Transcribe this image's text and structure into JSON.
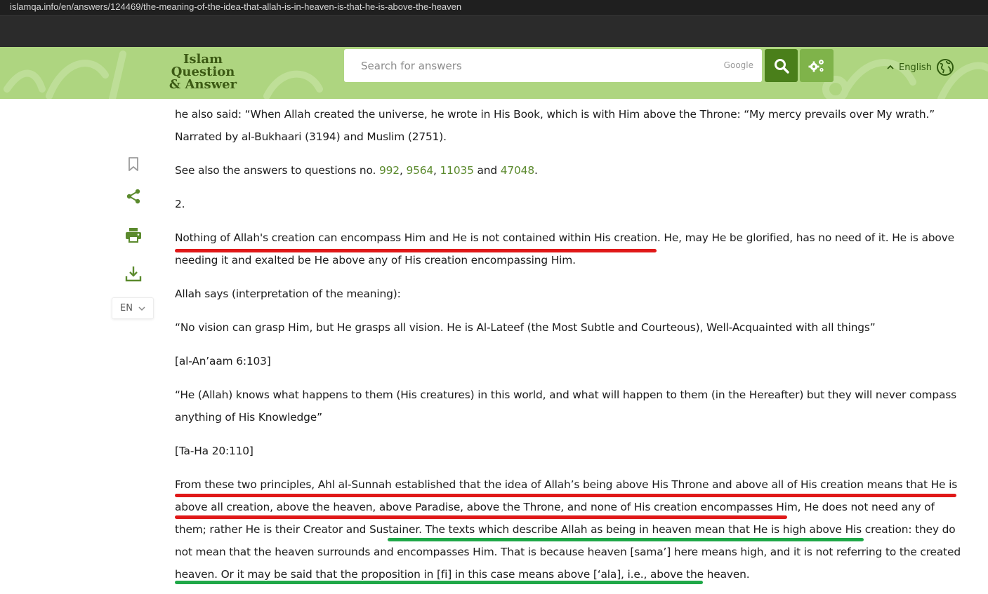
{
  "browser": {
    "url": "islamqa.info/en/answers/124469/the-meaning-of-the-idea-that-allah-is-in-heaven-is-that-he-is-above-the-heaven"
  },
  "header": {
    "logo_line1": "Islam Question",
    "logo_line2": "& Answer",
    "search_placeholder": "Search for answers",
    "search_provider": "Google",
    "language_label": "English",
    "colors": {
      "header_bg": "#aed580",
      "search_button": "#4a7f1a",
      "settings_button": "#7fb34a",
      "accent": "#5b8a2d"
    }
  },
  "sidebar_tools": {
    "icons": [
      "bookmark-icon",
      "share-icon",
      "print-icon",
      "download-icon"
    ],
    "language_code": "EN"
  },
  "article": {
    "p1": "he also said: “When Allah created the universe, he wrote in His Book, which is with Him above the Throne: “My mercy prevails over My wrath.” Narrated by al-Bukhaari (3194) and Muslim (2751).",
    "p2_prefix": "See also the answers to questions no. ",
    "p2_links": [
      "992",
      "9564",
      "11035",
      "47048"
    ],
    "p2_sep": ", ",
    "p2_and": " and ",
    "p2_suffix": ".",
    "p3": "2.",
    "p4": "Nothing of Allah's creation can encompass Him and He is not contained within His creation. He, may He be glorified, has no need of it. He is above needing it and exalted be He above any of His creation encompassing Him.",
    "p5": "Allah says (interpretation of the meaning):",
    "p6": "“No vision can grasp Him, but He grasps all vision. He is Al-Lateef (the Most Subtle and Courteous), Well-Acquainted with all things”",
    "p7": "[al-An’aam 6:103]",
    "p8": "“He (Allah) knows what happens to them (His creatures) in this world, and what will happen to them (in the Hereafter) but they will never compass anything of His Knowledge”",
    "p9": "[Ta-Ha 20:110]",
    "p10": "From these two principles, Ahl al-Sunnah established that the idea of Allah’s being above His Throne and above all of His creation means that He is above all creation, above the heaven, above Paradise, above the Throne, and none of His creation encompasses Him, He does not need any of them; rather He is their Creator and Sustainer. The texts which describe Allah as being in heaven mean that He is high above His creation: they do not mean that the heaven surrounds and encompasses Him. That is because heaven [sama’] here means high, and it is not referring to the created heaven. Or it may be said that the proposition in [fi] in this case means above [‘ala], i.e., above the heaven."
  },
  "annotations": {
    "red": "#e01818",
    "green": "#1fa848"
  }
}
